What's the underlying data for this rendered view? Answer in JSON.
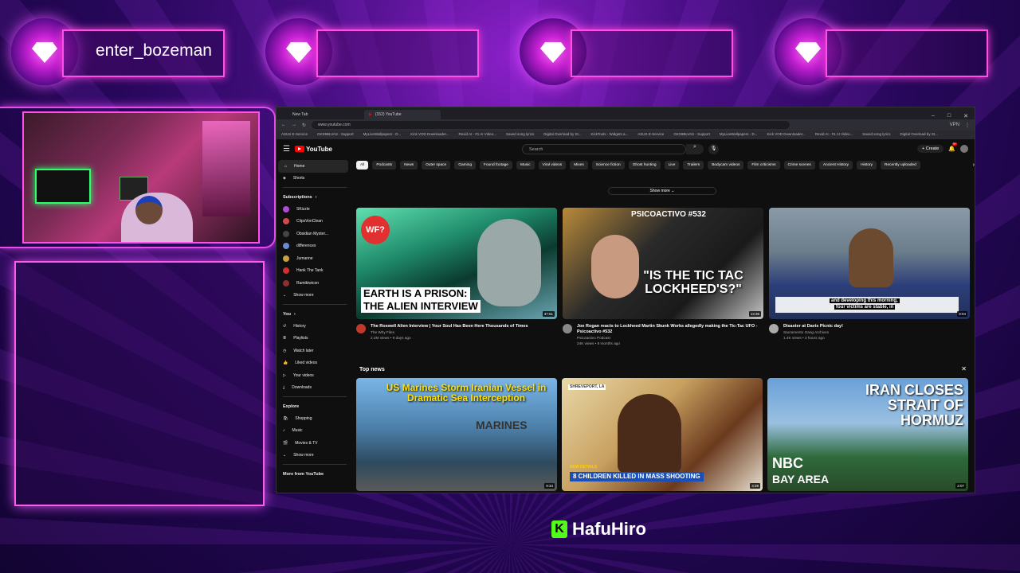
{
  "overlay": {
    "badges": [
      {
        "name": "enter_bozeman"
      },
      {
        "name": ""
      },
      {
        "name": ""
      },
      {
        "name": ""
      }
    ],
    "brand": {
      "logo_letter": "K",
      "name": "HafuHiro"
    }
  },
  "browser": {
    "tabs": [
      {
        "label": "New Tab"
      },
      {
        "label": "(152) YouTube"
      }
    ],
    "url": "www.youtube.com",
    "vpn_label": "VPN",
    "bookmarks": [
      "ASUS E-Service",
      "GKS9BLVAS - Support",
      "MyLiveWallpapers - D...",
      "Kick VOD Downloader...",
      "Revid AI - #1 AI Video...",
      "Saved song lyrics",
      "Digital Overload by St...",
      "KickTools - Widgets a...",
      "ASUS E-Service",
      "GKS9BLVAS - Support",
      "MyLiveWallpapers - D...",
      "Kick VOD Downloader...",
      "Revid AI - #1 AI Video...",
      "Saved song lyrics",
      "Digital Overload by St..."
    ]
  },
  "youtube": {
    "logo": "YouTube",
    "search_placeholder": "Search",
    "create_label": "Create",
    "notif_count": "9+",
    "sidebar": {
      "home": "Home",
      "shorts": "Shorts",
      "subscriptions_header": "Subscriptions",
      "subscriptions": [
        {
          "name": "SKizzle",
          "color": "#b04ad0"
        },
        {
          "name": "ClipsVonClean",
          "color": "#d04a4a"
        },
        {
          "name": "Obsidian Myster...",
          "color": "#444"
        },
        {
          "name": "differences",
          "color": "#6a8ad0"
        },
        {
          "name": "Jumanne",
          "color": "#c8a040"
        },
        {
          "name": "Hank The Tank",
          "color": "#d03030"
        },
        {
          "name": "Ramikiwicon",
          "color": "#8a3030"
        }
      ],
      "show_more": "Show more",
      "you_header": "You",
      "you_items": [
        "History",
        "Playlists",
        "Watch later",
        "Liked videos",
        "Your videos",
        "Downloads"
      ],
      "explore_header": "Explore",
      "explore_items": [
        "Shopping",
        "Music",
        "Movies & TV"
      ],
      "explore_more": "Show more",
      "more_from": "More from YouTube"
    },
    "chips": [
      "All",
      "Podcasts",
      "News",
      "Outer space",
      "Gaming",
      "Found footage",
      "Music",
      "Viral videos",
      "Mixes",
      "Science fiction",
      "Ghost hunting",
      "Live",
      "Trailers",
      "Bodycam videos",
      "Film criticisms",
      "Crime scenes",
      "Ancient History",
      "History",
      "Recently uploaded"
    ],
    "show_more_button": "Show more",
    "videos": [
      {
        "title": "The Roswell Alien Interview | Your Soul Has Been Here Thousands of Times",
        "channel": "The Why Files",
        "stats": "2.2M views • 9 days ago",
        "duration": "37:51",
        "thumb_text1": "EARTH IS A PRISON:",
        "thumb_text2": "THE ALIEN INTERVIEW",
        "badge": "WF?",
        "avatar_color": "#c0392b"
      },
      {
        "title": "Joe Rogan reacts to Lockheed Martin Skunk Works allegedly making the Tic-Tac UFO - Psicoactivo #532",
        "channel": "Psicoactivo Podcast",
        "stats": "24K views • 8 months ago",
        "duration": "13:36",
        "thumb_text1": "PSICOACTIVO #532",
        "thumb_text2": "\"IS THE TIC TAC LOCKHEED'S?\"",
        "avatar_color": "#888"
      },
      {
        "title": "Disaster at Davis Picnic day!",
        "channel": "Sacramento Gang Archives",
        "stats": "1.4K views • 3 hours ago",
        "duration": "8:04",
        "thumb_text1": "and developing this morning,",
        "thumb_text2": "four victims are stable, in",
        "avatar_color": "#aaa"
      }
    ],
    "top_news": {
      "title": "Top news",
      "items": [
        {
          "text": "US Marines Storm Iranian Vessel in Dramatic Sea Interception",
          "sub": "MARINES",
          "duration": "9:34"
        },
        {
          "tag": "NEW DETAILS",
          "text": "8 CHILDREN KILLED IN MASS SHOOTING",
          "loc": "SHREVEPORT, LA",
          "duration": "3:39"
        },
        {
          "text": "IRAN CLOSES STRAIT OF HORMUZ",
          "logo": "NBC",
          "logo2": "BAY AREA",
          "duration": "2:07"
        }
      ]
    }
  }
}
